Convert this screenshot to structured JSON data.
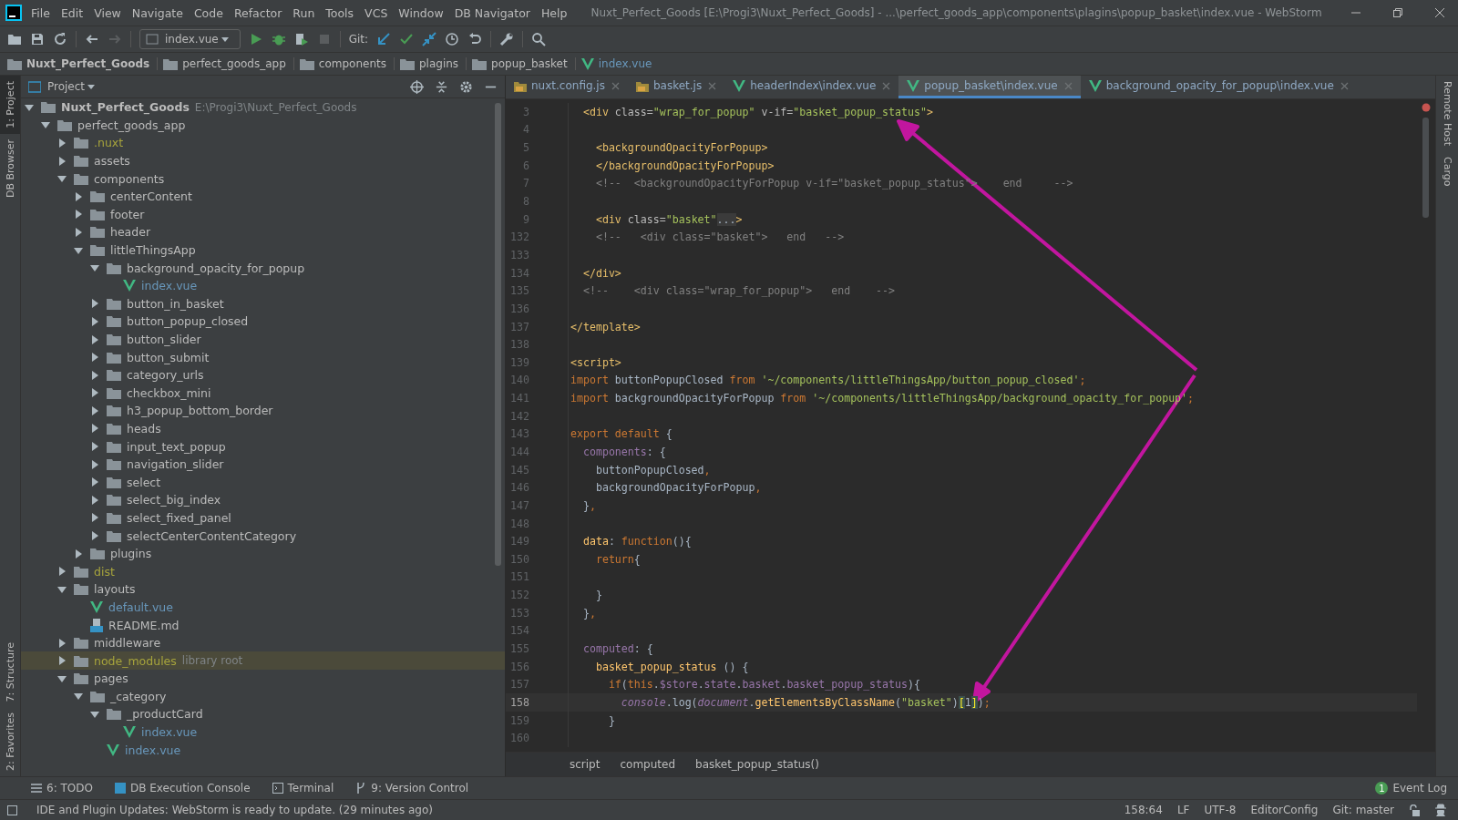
{
  "window": {
    "title": "Nuxt_Perfect_Goods [E:\\Progi3\\Nuxt_Perfect_Goods] - ...\\perfect_goods_app\\components\\plagins\\popup_basket\\index.vue - WebStorm",
    "menu": [
      "File",
      "Edit",
      "View",
      "Navigate",
      "Code",
      "Refactor",
      "Run",
      "Tools",
      "VCS",
      "Window",
      "DB Navigator",
      "Help"
    ]
  },
  "toolbar": {
    "run_config": "index.vue",
    "git_label": "Git:"
  },
  "breadcrumb": [
    {
      "label": "Nuxt_Perfect_Goods",
      "kind": "project"
    },
    {
      "label": "perfect_goods_app",
      "kind": "folder"
    },
    {
      "label": "components",
      "kind": "folder"
    },
    {
      "label": "plagins",
      "kind": "folder"
    },
    {
      "label": "popup_basket",
      "kind": "folder"
    },
    {
      "label": "index.vue",
      "kind": "vue"
    }
  ],
  "left_stripe": [
    {
      "label": "1: Project",
      "selected": true
    },
    {
      "label": "DB Browser",
      "selected": false
    },
    {
      "label": "7: Structure",
      "selected": false
    },
    {
      "label": "2: Favorites",
      "selected": false
    }
  ],
  "right_stripe": [
    "Remote Host",
    "Cargo"
  ],
  "project": {
    "title": "Project",
    "tree": [
      {
        "name": "Nuxt_Perfect_Goods",
        "kind": "root",
        "hint": "E:\\Progi3\\Nuxt_Perfect_Goods",
        "expanded": true,
        "children": [
          {
            "name": "perfect_goods_app",
            "kind": "folder",
            "expanded": true,
            "children": [
              {
                "name": ".nuxt",
                "kind": "folder",
                "excluded": true,
                "expanded": false
              },
              {
                "name": "assets",
                "kind": "folder",
                "expanded": false
              },
              {
                "name": "components",
                "kind": "folder",
                "expanded": true,
                "children": [
                  {
                    "name": "centerContent",
                    "kind": "folder",
                    "expanded": false
                  },
                  {
                    "name": "footer",
                    "kind": "folder",
                    "expanded": false
                  },
                  {
                    "name": "header",
                    "kind": "folder",
                    "expanded": false
                  },
                  {
                    "name": "littleThingsApp",
                    "kind": "folder",
                    "expanded": true,
                    "children": [
                      {
                        "name": "background_opacity_for_popup",
                        "kind": "folder",
                        "expanded": true,
                        "children": [
                          {
                            "name": "index.vue",
                            "kind": "vue"
                          }
                        ]
                      },
                      {
                        "name": "button_in_basket",
                        "kind": "folder",
                        "expanded": false
                      },
                      {
                        "name": "button_popup_closed",
                        "kind": "folder",
                        "expanded": false
                      },
                      {
                        "name": "button_slider",
                        "kind": "folder",
                        "expanded": false
                      },
                      {
                        "name": "button_submit",
                        "kind": "folder",
                        "expanded": false
                      },
                      {
                        "name": "category_urls",
                        "kind": "folder",
                        "expanded": false
                      },
                      {
                        "name": "checkbox_mini",
                        "kind": "folder",
                        "expanded": false
                      },
                      {
                        "name": "h3_popup_bottom_border",
                        "kind": "folder",
                        "expanded": false
                      },
                      {
                        "name": "heads",
                        "kind": "folder",
                        "expanded": false
                      },
                      {
                        "name": "input_text_popup",
                        "kind": "folder",
                        "expanded": false
                      },
                      {
                        "name": "navigation_slider",
                        "kind": "folder",
                        "expanded": false
                      },
                      {
                        "name": "select",
                        "kind": "folder",
                        "expanded": false
                      },
                      {
                        "name": "select_big_index",
                        "kind": "folder",
                        "expanded": false
                      },
                      {
                        "name": "select_fixed_panel",
                        "kind": "folder",
                        "expanded": false
                      },
                      {
                        "name": "selectCenterContentCategory",
                        "kind": "folder",
                        "expanded": false
                      }
                    ]
                  },
                  {
                    "name": "plugins",
                    "kind": "folder",
                    "expanded": false
                  }
                ]
              },
              {
                "name": "dist",
                "kind": "folder",
                "excluded": true,
                "expanded": false
              },
              {
                "name": "layouts",
                "kind": "folder",
                "expanded": true,
                "children": [
                  {
                    "name": "default.vue",
                    "kind": "vue"
                  },
                  {
                    "name": "README.md",
                    "kind": "md"
                  }
                ]
              },
              {
                "name": "middleware",
                "kind": "folder",
                "expanded": false
              },
              {
                "name": "node_modules",
                "kind": "folder",
                "excluded": true,
                "hint": "library root",
                "highlighted": true,
                "expanded": false
              },
              {
                "name": "pages",
                "kind": "folder",
                "expanded": true,
                "children": [
                  {
                    "name": "_category",
                    "kind": "folder",
                    "expanded": true,
                    "children": [
                      {
                        "name": "_productCard",
                        "kind": "folder",
                        "expanded": true,
                        "children": [
                          {
                            "name": "index.vue",
                            "kind": "vue"
                          }
                        ]
                      },
                      {
                        "name": "index.vue",
                        "kind": "vue"
                      }
                    ]
                  }
                ]
              }
            ]
          }
        ]
      }
    ]
  },
  "tabs": [
    {
      "label": "nuxt.config.js",
      "kind": "js",
      "selected": false
    },
    {
      "label": "basket.js",
      "kind": "js",
      "selected": false
    },
    {
      "label": "headerIndex\\index.vue",
      "kind": "vue",
      "selected": false
    },
    {
      "label": "popup_basket\\index.vue",
      "kind": "vue",
      "selected": true
    },
    {
      "label": "background_opacity_for_popup\\index.vue",
      "kind": "vue",
      "selected": false
    }
  ],
  "editor": {
    "lines": [
      {
        "number": "3",
        "current": false,
        "tokens": [
          {
            "text": "  <div",
            "kind": "tag"
          },
          {
            "text": " class=",
            "kind": "attr"
          },
          {
            "text": "\"wrap_for_popup\"",
            "kind": "str"
          },
          {
            "text": " v-if=",
            "kind": "attr"
          },
          {
            "text": "\"basket_popup_status\"",
            "kind": "str"
          },
          {
            "text": ">",
            "kind": "tag"
          }
        ]
      },
      {
        "number": "4",
        "current": false
      },
      {
        "number": "5",
        "current": false,
        "tokens": [
          {
            "text": "    <backgroundOpacityForPopup>",
            "kind": "tag"
          }
        ]
      },
      {
        "number": "6",
        "current": false,
        "tokens": [
          {
            "text": "    </backgroundOpacityForPopup>",
            "kind": "tag"
          }
        ]
      },
      {
        "number": "7",
        "current": false,
        "tokens": [
          {
            "text": "    <!--  <backgroundOpacityForPopup v-if=\"basket_popup_status\">    end     -->",
            "kind": "comment"
          }
        ]
      },
      {
        "number": "8",
        "current": false
      },
      {
        "number": "9",
        "current": false,
        "tokens": [
          {
            "text": "    <div",
            "kind": "tag"
          },
          {
            "text": " class=",
            "kind": "attr"
          },
          {
            "text": "\"basket\"",
            "kind": "str"
          },
          {
            "text": "...",
            "kind": "fold"
          },
          {
            "text": ">",
            "kind": "tag"
          }
        ]
      },
      {
        "number": "132",
        "current": false,
        "tokens": [
          {
            "text": "    <!--   <div class=\"basket\">   end   -->",
            "kind": "comment"
          }
        ]
      },
      {
        "number": "133",
        "current": false
      },
      {
        "number": "134",
        "current": false,
        "tokens": [
          {
            "text": "  </div>",
            "kind": "tag"
          }
        ]
      },
      {
        "number": "135",
        "current": false,
        "tokens": [
          {
            "text": "  <!--    <div class=\"wrap_for_popup\">   end    -->",
            "kind": "comment"
          }
        ]
      },
      {
        "number": "136",
        "current": false
      },
      {
        "number": "137",
        "current": false,
        "tokens": [
          {
            "text": "</template>",
            "kind": "tag"
          }
        ]
      },
      {
        "number": "138",
        "current": false
      },
      {
        "number": "139",
        "current": false,
        "tokens": [
          {
            "text": "<script>",
            "kind": "tag"
          }
        ]
      },
      {
        "number": "140",
        "current": false,
        "tokens": [
          {
            "text": "import",
            "kind": "kw"
          },
          {
            "text": " buttonPopupClosed ",
            "kind": "plain"
          },
          {
            "text": "from",
            "kind": "kw"
          },
          {
            "text": " '~/components/littleThingsApp/button_popup_closed'",
            "kind": "str"
          },
          {
            "text": ";",
            "kind": "kw"
          }
        ]
      },
      {
        "number": "141",
        "current": false,
        "tokens": [
          {
            "text": "import",
            "kind": "kw"
          },
          {
            "text": " backgroundOpacityForPopup ",
            "kind": "plain"
          },
          {
            "text": "from",
            "kind": "kw"
          },
          {
            "text": " '~/components/littleThingsApp/background_opacity_for_popup'",
            "kind": "str"
          },
          {
            "text": ";",
            "kind": "kw"
          }
        ]
      },
      {
        "number": "142",
        "current": false
      },
      {
        "number": "143",
        "current": false,
        "tokens": [
          {
            "text": "export default",
            "kind": "kw"
          },
          {
            "text": " {",
            "kind": "plain"
          }
        ]
      },
      {
        "number": "144",
        "current": false,
        "tokens": [
          {
            "text": "  components",
            "kind": "prop"
          },
          {
            "text": ": {",
            "kind": "plain"
          }
        ]
      },
      {
        "number": "145",
        "current": false,
        "tokens": [
          {
            "text": "    buttonPopupClosed",
            "kind": "plain"
          },
          {
            "text": ",",
            "kind": "kw"
          }
        ]
      },
      {
        "number": "146",
        "current": false,
        "tokens": [
          {
            "text": "    backgroundOpacityForPopup",
            "kind": "plain"
          },
          {
            "text": ",",
            "kind": "kw"
          }
        ]
      },
      {
        "number": "147",
        "current": false,
        "tokens": [
          {
            "text": "  }",
            "kind": "plain"
          },
          {
            "text": ",",
            "kind": "kw"
          }
        ]
      },
      {
        "number": "148",
        "current": false
      },
      {
        "number": "149",
        "current": false,
        "tokens": [
          {
            "text": "  data",
            "kind": "fn"
          },
          {
            "text": ": ",
            "kind": "plain"
          },
          {
            "text": "function",
            "kind": "kw"
          },
          {
            "text": "(){",
            "kind": "plain"
          }
        ]
      },
      {
        "number": "150",
        "current": false,
        "tokens": [
          {
            "text": "    return",
            "kind": "kw"
          },
          {
            "text": "{",
            "kind": "plain"
          }
        ]
      },
      {
        "number": "151",
        "current": false
      },
      {
        "number": "152",
        "current": false,
        "tokens": [
          {
            "text": "    }",
            "kind": "plain"
          }
        ]
      },
      {
        "number": "153",
        "current": false,
        "tokens": [
          {
            "text": "  }",
            "kind": "plain"
          },
          {
            "text": ",",
            "kind": "kw"
          }
        ]
      },
      {
        "number": "154",
        "current": false
      },
      {
        "number": "155",
        "current": false,
        "tokens": [
          {
            "text": "  computed",
            "kind": "prop"
          },
          {
            "text": ": {",
            "kind": "plain"
          }
        ]
      },
      {
        "number": "156",
        "current": false,
        "tokens": [
          {
            "text": "    basket_popup_status",
            "kind": "fn"
          },
          {
            "text": " () {",
            "kind": "plain"
          }
        ]
      },
      {
        "number": "157",
        "current": false,
        "tokens": [
          {
            "text": "      if",
            "kind": "kw"
          },
          {
            "text": "(",
            "kind": "plain"
          },
          {
            "text": "this",
            "kind": "kw"
          },
          {
            "text": ".",
            "kind": "plain"
          },
          {
            "text": "$store",
            "kind": "prop"
          },
          {
            "text": ".",
            "kind": "plain"
          },
          {
            "text": "state",
            "kind": "prop"
          },
          {
            "text": ".",
            "kind": "plain"
          },
          {
            "text": "basket",
            "kind": "prop"
          },
          {
            "text": ".",
            "kind": "plain"
          },
          {
            "text": "basket_popup_status",
            "kind": "prop"
          },
          {
            "text": "){",
            "kind": "plain"
          }
        ]
      },
      {
        "number": "158",
        "current": true,
        "tokens": [
          {
            "text": "        console",
            "kind": "global"
          },
          {
            "text": ".log(",
            "kind": "plain"
          },
          {
            "text": "document",
            "kind": "global"
          },
          {
            "text": ".",
            "kind": "plain"
          },
          {
            "text": "getElementsByClassName",
            "kind": "fn"
          },
          {
            "text": "(",
            "kind": "plain"
          },
          {
            "text": "\"basket\"",
            "kind": "str"
          },
          {
            "text": ")",
            "kind": "plain"
          },
          {
            "text": "[",
            "kind": "bracket"
          },
          {
            "text": "1",
            "kind": "plain"
          },
          {
            "text": "]",
            "kind": "bracket"
          },
          {
            "text": ")",
            "kind": "plain"
          },
          {
            "text": ";",
            "kind": "kw"
          }
        ]
      },
      {
        "number": "159",
        "current": false,
        "tokens": [
          {
            "text": "      }",
            "kind": "plain"
          }
        ]
      },
      {
        "number": "160",
        "current": false
      }
    ],
    "breadcrumb": [
      "script",
      "computed",
      "basket_popup_status()"
    ]
  },
  "tool_windows": [
    {
      "label": "6: TODO",
      "kind": "todo"
    },
    {
      "label": "DB Execution Console",
      "kind": "db"
    },
    {
      "label": "Terminal",
      "kind": "terminal"
    },
    {
      "label": "9: Version Control",
      "kind": "vcs"
    }
  ],
  "event_log": {
    "label": "Event Log",
    "count": "1"
  },
  "status_bar": {
    "message": "IDE and Plugin Updates: WebStorm is ready to update. (29 minutes ago)",
    "items": [
      "158:64",
      "LF",
      "UTF-8",
      "EditorConfig",
      "Git: master"
    ]
  }
}
